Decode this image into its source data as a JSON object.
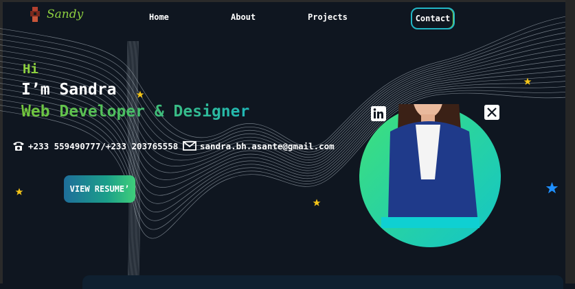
{
  "brand": {
    "name": "Sandy"
  },
  "nav": {
    "home": "Home",
    "about": "About",
    "projects": "Projects",
    "contact": "Contact"
  },
  "hero": {
    "greeting": "Hi",
    "name_line": "I’m Sandra",
    "role_line": "Web Developer & Designer",
    "phone": "+233 559490777/+233 203765558",
    "email": "sandra.bh.asante@gmail.com",
    "resume_button": "VIEW RESUME’"
  },
  "icons": [
    "logo-icon",
    "phone-icon",
    "mail-icon",
    "linkedin-icon",
    "x-icon",
    "star-icon"
  ],
  "colors": {
    "background": "#0f1620",
    "accent_green": "#8ed13f",
    "accent_teal": "#1fb7b7",
    "star_yellow": "#f5c518",
    "star_blue": "#1e8fff"
  }
}
